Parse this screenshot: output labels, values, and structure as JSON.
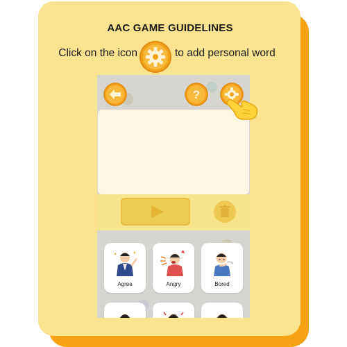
{
  "title": "AAC GAME GUIDELINES",
  "instruction": {
    "before_icon": "Click on the icon",
    "icon": "gear-icon",
    "after_icon": "to add personal word"
  },
  "phone": {
    "top_buttons": [
      "back-arrow-icon",
      "help-icon",
      "gear-icon"
    ],
    "text_area": "",
    "controls": [
      "play-icon",
      "trash-icon"
    ],
    "tiles": [
      {
        "label": "Agree"
      },
      {
        "label": "Angry"
      },
      {
        "label": "Bored"
      },
      {
        "label": ""
      },
      {
        "label": ""
      },
      {
        "label": ""
      }
    ]
  },
  "colors": {
    "card": "#FBE38F",
    "card_shadow": "#F5A214",
    "button_orange": "#F7A41A",
    "control_bar": "#F6E58C",
    "text_area": "#FCF6E2"
  }
}
